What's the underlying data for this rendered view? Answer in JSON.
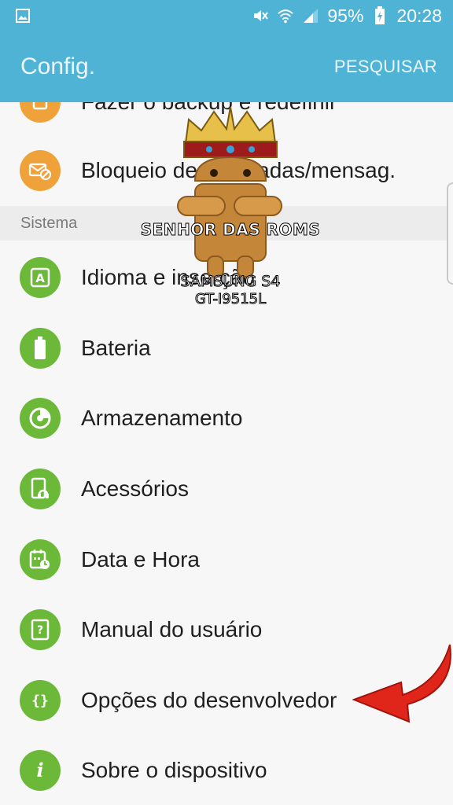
{
  "status_bar": {
    "battery": "95%",
    "time": "20:28"
  },
  "app_bar": {
    "title": "Config.",
    "search_label": "PESQUISAR"
  },
  "list": {
    "partial_item": {
      "label": "Fazer o backup e redefinir",
      "icon": "backup-icon",
      "color": "#f0a23a"
    },
    "blocked_item": {
      "label": "Bloqueio de chamadas/mensag.",
      "icon": "block-calls-icon",
      "color": "#f0a23a"
    },
    "section_header": "Sistema",
    "items": [
      {
        "label": "Idioma e inserção",
        "icon": "language-icon"
      },
      {
        "label": "Bateria",
        "icon": "battery-icon"
      },
      {
        "label": "Armazenamento",
        "icon": "storage-icon"
      },
      {
        "label": "Acessórios",
        "icon": "accessories-icon"
      },
      {
        "label": "Data e Hora",
        "icon": "date-time-icon"
      },
      {
        "label": "Manual do usuário",
        "icon": "user-manual-icon"
      },
      {
        "label": "Opções do desenvolvedor",
        "icon": "developer-options-icon"
      },
      {
        "label": "Sobre o dispositivo",
        "icon": "about-device-icon"
      }
    ],
    "system_color": "#6cb93a"
  },
  "watermark": {
    "title": "SENHOR DAS ROMS",
    "model": "SAMSUNG S4",
    "code": "GT-I9515L"
  },
  "colors": {
    "accent": "#4fb3d6",
    "arrow": "#e0261a"
  }
}
